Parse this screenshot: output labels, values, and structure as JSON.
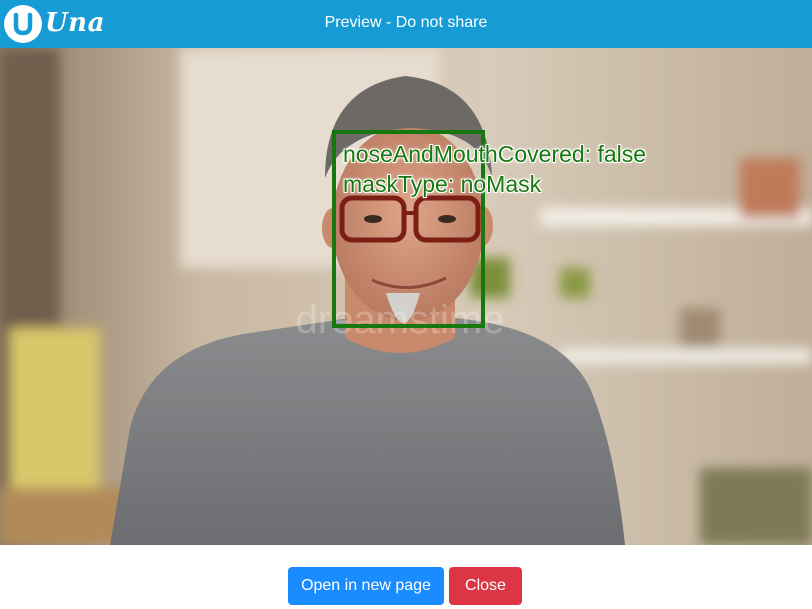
{
  "header": {
    "logo_text": "Una",
    "title": "Preview - Do not share",
    "background_color": "#169bd5"
  },
  "preview": {
    "detection": {
      "line1": "noseAndMouthCovered: false",
      "line2": "maskType: noMask",
      "color": "#17780f"
    },
    "watermark": "dreamstime"
  },
  "footer": {
    "open_label": "Open in new page",
    "close_label": "Close",
    "open_color": "#1a8cff",
    "close_color": "#dc3545"
  }
}
